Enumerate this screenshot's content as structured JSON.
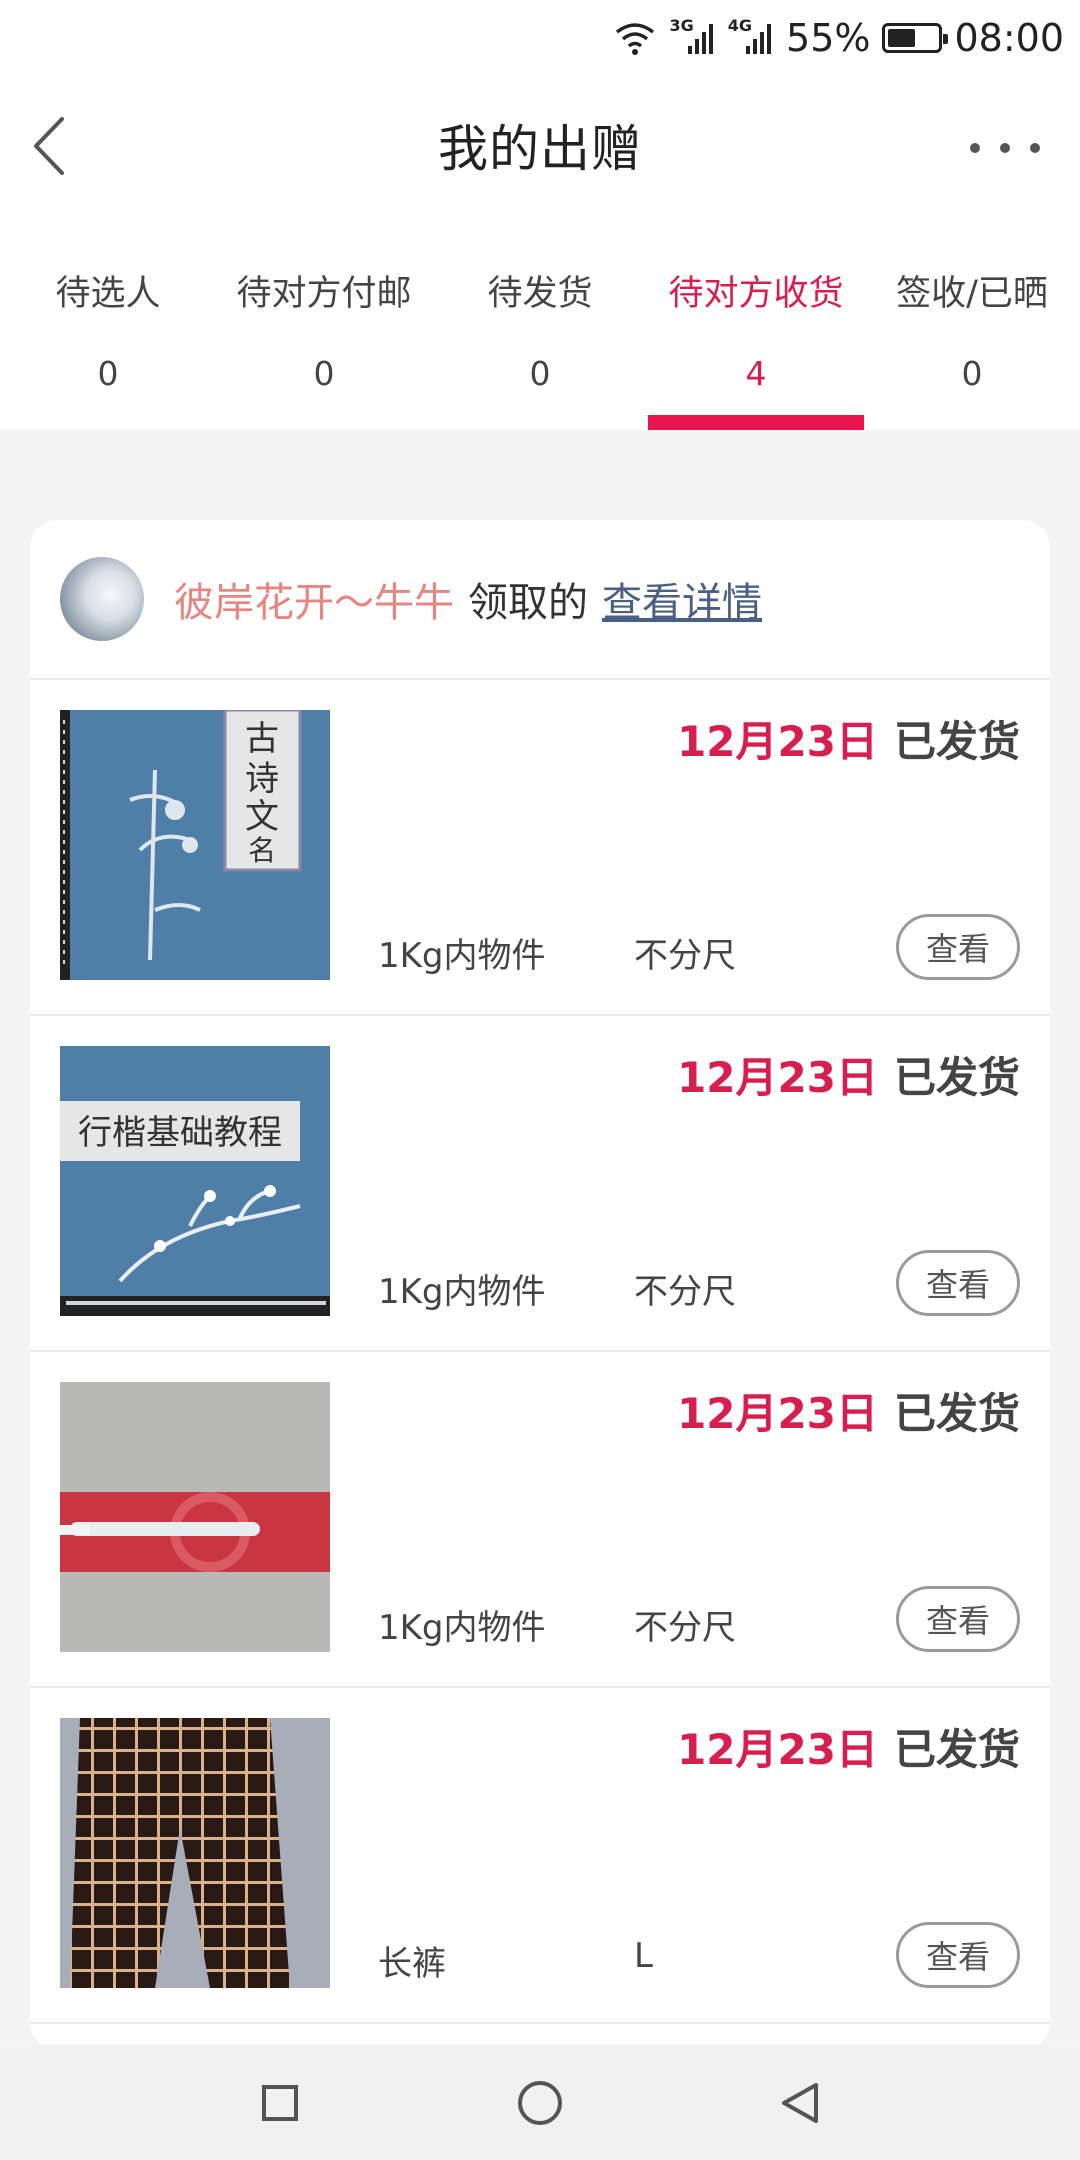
{
  "status_bar": {
    "network_3g": "3G",
    "network_4g": "4G",
    "battery_percent": "55%",
    "time": "08:00",
    "battery_level": 0.55
  },
  "header": {
    "title": "我的出赠"
  },
  "tabs": [
    {
      "label": "待选人",
      "count": "0",
      "active": false
    },
    {
      "label": "待对方付邮",
      "count": "0",
      "active": false
    },
    {
      "label": "待发货",
      "count": "0",
      "active": false
    },
    {
      "label": "待对方收货",
      "count": "4",
      "active": true
    },
    {
      "label": "签收/已晒",
      "count": "0",
      "active": false
    }
  ],
  "card": {
    "receiver_name": "彼岸花开～牛牛",
    "received_text": "领取的",
    "details_link": "查看详情",
    "items": [
      {
        "date": "12月23日",
        "status": "已发货",
        "weight": "1Kg内物件",
        "size": "不分尺",
        "view_label": "查看",
        "thumb": "calligraphy-book-bamboo"
      },
      {
        "date": "12月23日",
        "status": "已发货",
        "weight": "1Kg内物件",
        "size": "不分尺",
        "view_label": "查看",
        "thumb": "calligraphy-book-plum"
      },
      {
        "date": "12月23日",
        "status": "已发货",
        "weight": "1Kg内物件",
        "size": "不分尺",
        "view_label": "查看",
        "thumb": "makeup-brush"
      },
      {
        "date": "12月23日",
        "status": "已发货",
        "weight": "长裤",
        "size": "L",
        "view_label": "查看",
        "thumb": "plaid-trousers"
      }
    ]
  },
  "colors": {
    "accent": "#e8154f",
    "accent_text": "#d81e4f",
    "receiver_name": "#e88580",
    "link": "#4a5f86"
  },
  "nav": {
    "recents_icon": "square-icon",
    "home_icon": "circle-icon",
    "back_icon": "triangle-back-icon"
  }
}
